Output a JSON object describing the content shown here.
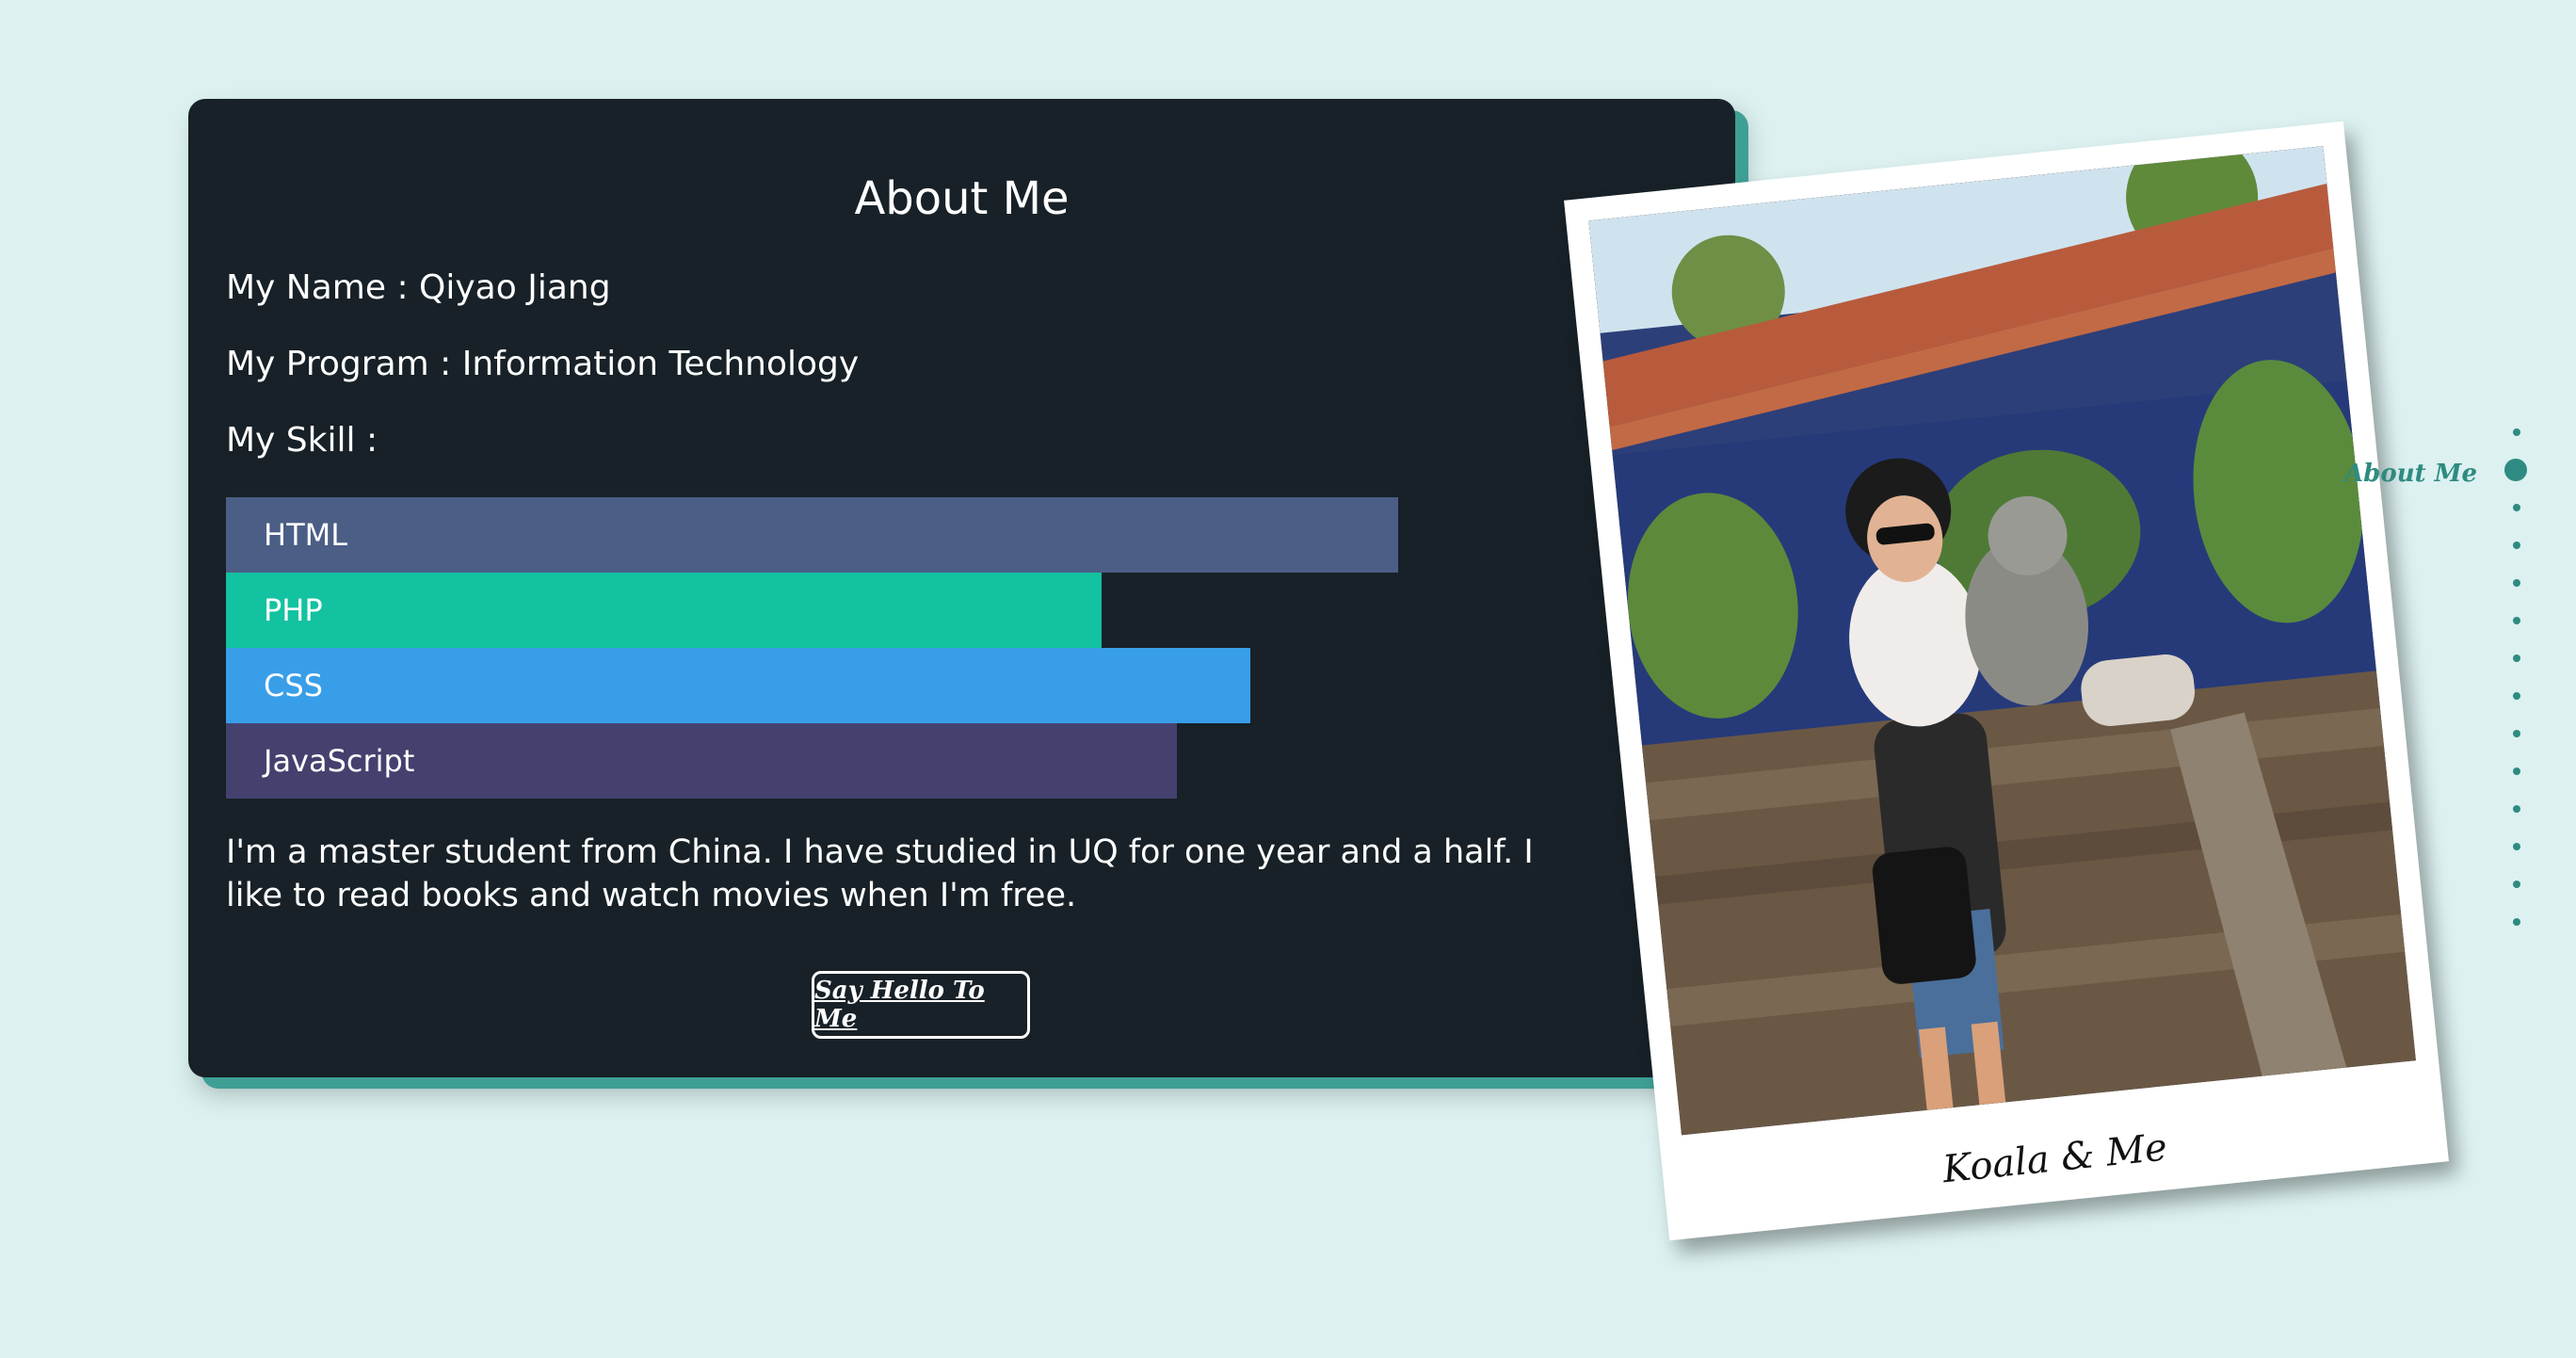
{
  "card": {
    "title": "About Me",
    "name_line": "My Name : Qiyao Jiang",
    "program_line": "My Program : Information Technology",
    "skill_heading": "My Skill :",
    "skills": [
      {
        "label": "HTML",
        "level": 0.83,
        "color": "#4b5e86"
      },
      {
        "label": "PHP",
        "level": 0.62,
        "color": "#13c2a0"
      },
      {
        "label": "CSS",
        "level": 0.725,
        "color": "#399ee8"
      },
      {
        "label": "JavaScript",
        "level": 0.673,
        "color": "#44416f"
      }
    ],
    "bio": "I'm a master student from China. I have studied in UQ for one year and a half. I like to read books and watch movies when I'm free.",
    "hello_button": "Say Hello To Me"
  },
  "photo": {
    "caption": "Koala & Me"
  },
  "side_nav": {
    "active_label": "About Me",
    "accent": "#2e8b81"
  }
}
